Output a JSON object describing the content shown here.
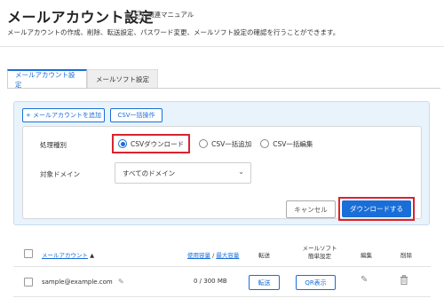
{
  "header": {
    "title": "メールアカウント設定",
    "manual_link": "関連マニュアル",
    "description": "メールアカウントの作成、削除、転送設定、パスワード変更、メールソフト設定の確認を行うことができます。"
  },
  "tabs": [
    {
      "label": "メールアカウント設定",
      "active": true
    },
    {
      "label": "メールソフト設定",
      "active": false
    }
  ],
  "panel": {
    "add_button": "+ メールアカウントを追加",
    "csv_button": "CSV一括操作",
    "process_type_label": "処理種別",
    "radios": [
      {
        "label": "CSVダウンロード",
        "selected": true
      },
      {
        "label": "CSV一括追加",
        "selected": false
      },
      {
        "label": "CSV一括編集",
        "selected": false
      }
    ],
    "domain_label": "対象ドメイン",
    "domain_value": "すべてのドメイン",
    "cancel_button": "キャンセル",
    "download_button": "ダウンロードする"
  },
  "table": {
    "headers": {
      "account": "メールアカウント",
      "sort_indicator": "▲",
      "usage_used": "使用容量",
      "usage_sep": " / ",
      "usage_max": "最大容量",
      "forward": "転送",
      "mail_soft_1": "メールソフト",
      "mail_soft_2": "簡単設定",
      "edit": "編集",
      "delete": "削除"
    },
    "rows": [
      {
        "account": "sample@example.com",
        "usage": "0 / 300 MB",
        "forward_button": "転送",
        "qr_button": "QR表示"
      }
    ]
  },
  "colors": {
    "accent": "#1a6ed8",
    "highlight": "#d9232e",
    "panel_bg": "#e9f3fc"
  },
  "icons": {
    "help": "question-circle-icon",
    "chevron": "chevron-down-icon",
    "pencil": "pencil-icon",
    "edit": "edit-icon",
    "trash": "trash-icon"
  }
}
